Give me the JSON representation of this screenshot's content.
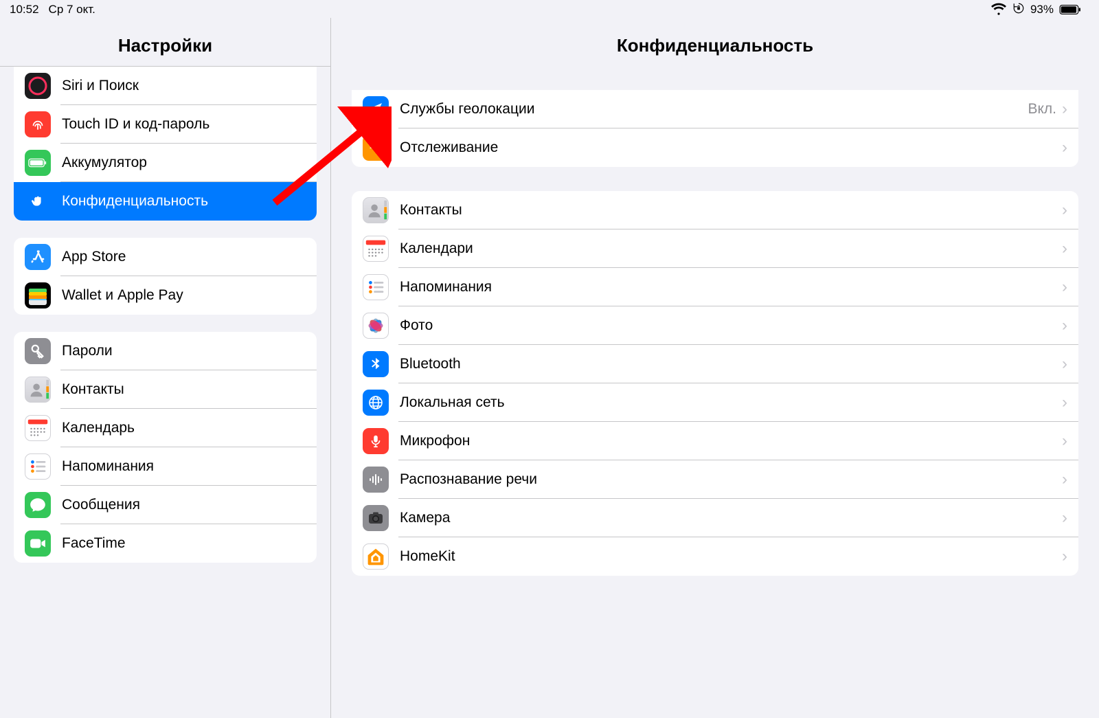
{
  "status": {
    "time": "10:52",
    "date": "Ср 7 окт.",
    "battery": "93%"
  },
  "sidebar": {
    "title": "Настройки",
    "groups": [
      {
        "items": [
          {
            "icon": "siri",
            "bg": "#1c1c1e",
            "label": "Siri и Поиск"
          },
          {
            "icon": "touchid",
            "bg": "#ff3b30",
            "label": "Touch ID и код-пароль"
          },
          {
            "icon": "battery",
            "bg": "#34c759",
            "label": "Аккумулятор"
          },
          {
            "icon": "privacy",
            "bg": "#007aff",
            "label": "Конфиденциальность",
            "selected": true
          }
        ]
      },
      {
        "items": [
          {
            "icon": "appstore",
            "bg": "#1e90ff",
            "label": "App Store"
          },
          {
            "icon": "wallet",
            "bg": "#000",
            "label": "Wallet и Apple Pay"
          }
        ]
      },
      {
        "items": [
          {
            "icon": "passwords",
            "bg": "#8e8e93",
            "label": "Пароли"
          },
          {
            "icon": "contacts",
            "bg": "#fff",
            "label": "Контакты"
          },
          {
            "icon": "calendar",
            "bg": "#fff",
            "label": "Календарь"
          },
          {
            "icon": "reminders",
            "bg": "#fff",
            "label": "Напоминания"
          },
          {
            "icon": "messages",
            "bg": "#34c759",
            "label": "Сообщения"
          },
          {
            "icon": "facetime",
            "bg": "#34c759",
            "label": "FaceTime"
          }
        ]
      }
    ]
  },
  "main": {
    "title": "Конфиденциальность",
    "groups": [
      {
        "items": [
          {
            "icon": "location",
            "bg": "#007aff",
            "label": "Службы геолокации",
            "value": "Вкл."
          },
          {
            "icon": "tracking",
            "bg": "#ff9500",
            "label": "Отслеживание"
          }
        ]
      },
      {
        "items": [
          {
            "icon": "contacts",
            "bg": "#fff",
            "label": "Контакты"
          },
          {
            "icon": "calendar",
            "bg": "#fff",
            "label": "Календари"
          },
          {
            "icon": "reminders",
            "bg": "#fff",
            "label": "Напоминания"
          },
          {
            "icon": "photos",
            "bg": "#fff",
            "label": "Фото"
          },
          {
            "icon": "bluetooth",
            "bg": "#007aff",
            "label": "Bluetooth"
          },
          {
            "icon": "network",
            "bg": "#007aff",
            "label": "Локальная сеть"
          },
          {
            "icon": "mic",
            "bg": "#ff3b30",
            "label": "Микрофон"
          },
          {
            "icon": "speech",
            "bg": "#8e8e93",
            "label": "Распознавание речи"
          },
          {
            "icon": "camera",
            "bg": "#8e8e93",
            "label": "Камера"
          },
          {
            "icon": "homekit",
            "bg": "#fff",
            "label": "HomeKit"
          }
        ]
      }
    ]
  }
}
